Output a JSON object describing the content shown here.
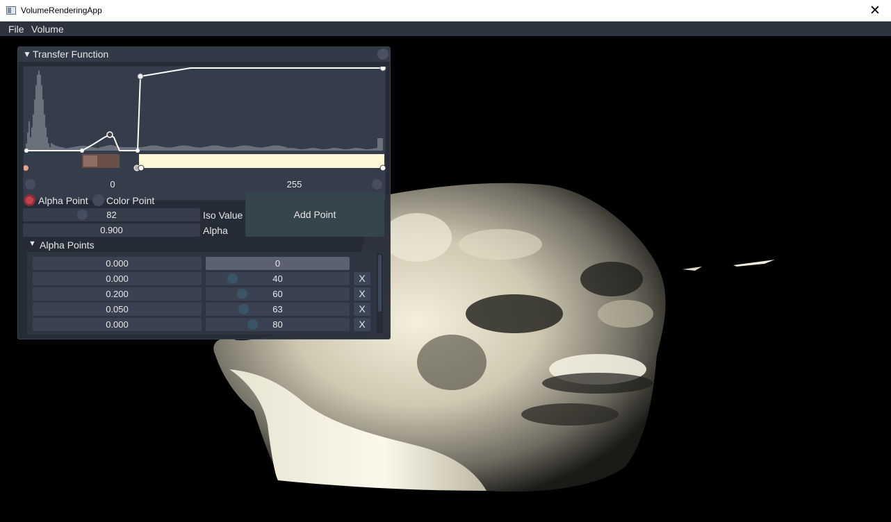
{
  "window": {
    "title": "VolumeRenderingApp",
    "close_glyph": "✕"
  },
  "menu": {
    "items": [
      "File",
      "Volume"
    ]
  },
  "panel": {
    "title": "Transfer Function",
    "range": {
      "min": "0",
      "max": "255"
    },
    "mode": {
      "alpha_label": "Alpha Point",
      "color_label": "Color Point",
      "selected": "Alpha Point"
    },
    "iso_value": "82",
    "iso_label": "Iso Value",
    "alpha_value": "0.900",
    "alpha_label": "Alpha",
    "add_point_label": "Add Point",
    "alpha_points_title": "Alpha Points",
    "alpha_points": [
      {
        "alpha": "0.000",
        "iso": "0",
        "removable": false
      },
      {
        "alpha": "0.000",
        "iso": "40",
        "removable": true
      },
      {
        "alpha": "0.200",
        "iso": "60",
        "removable": true
      },
      {
        "alpha": "0.050",
        "iso": "63",
        "removable": true
      },
      {
        "alpha": "0.000",
        "iso": "80",
        "removable": true
      }
    ],
    "remove_label": "X",
    "colors": {
      "accent_red": "#c4424e",
      "color_bar_cream": "#fdf7d7",
      "color_bar_brown": "#7a5a52"
    }
  }
}
